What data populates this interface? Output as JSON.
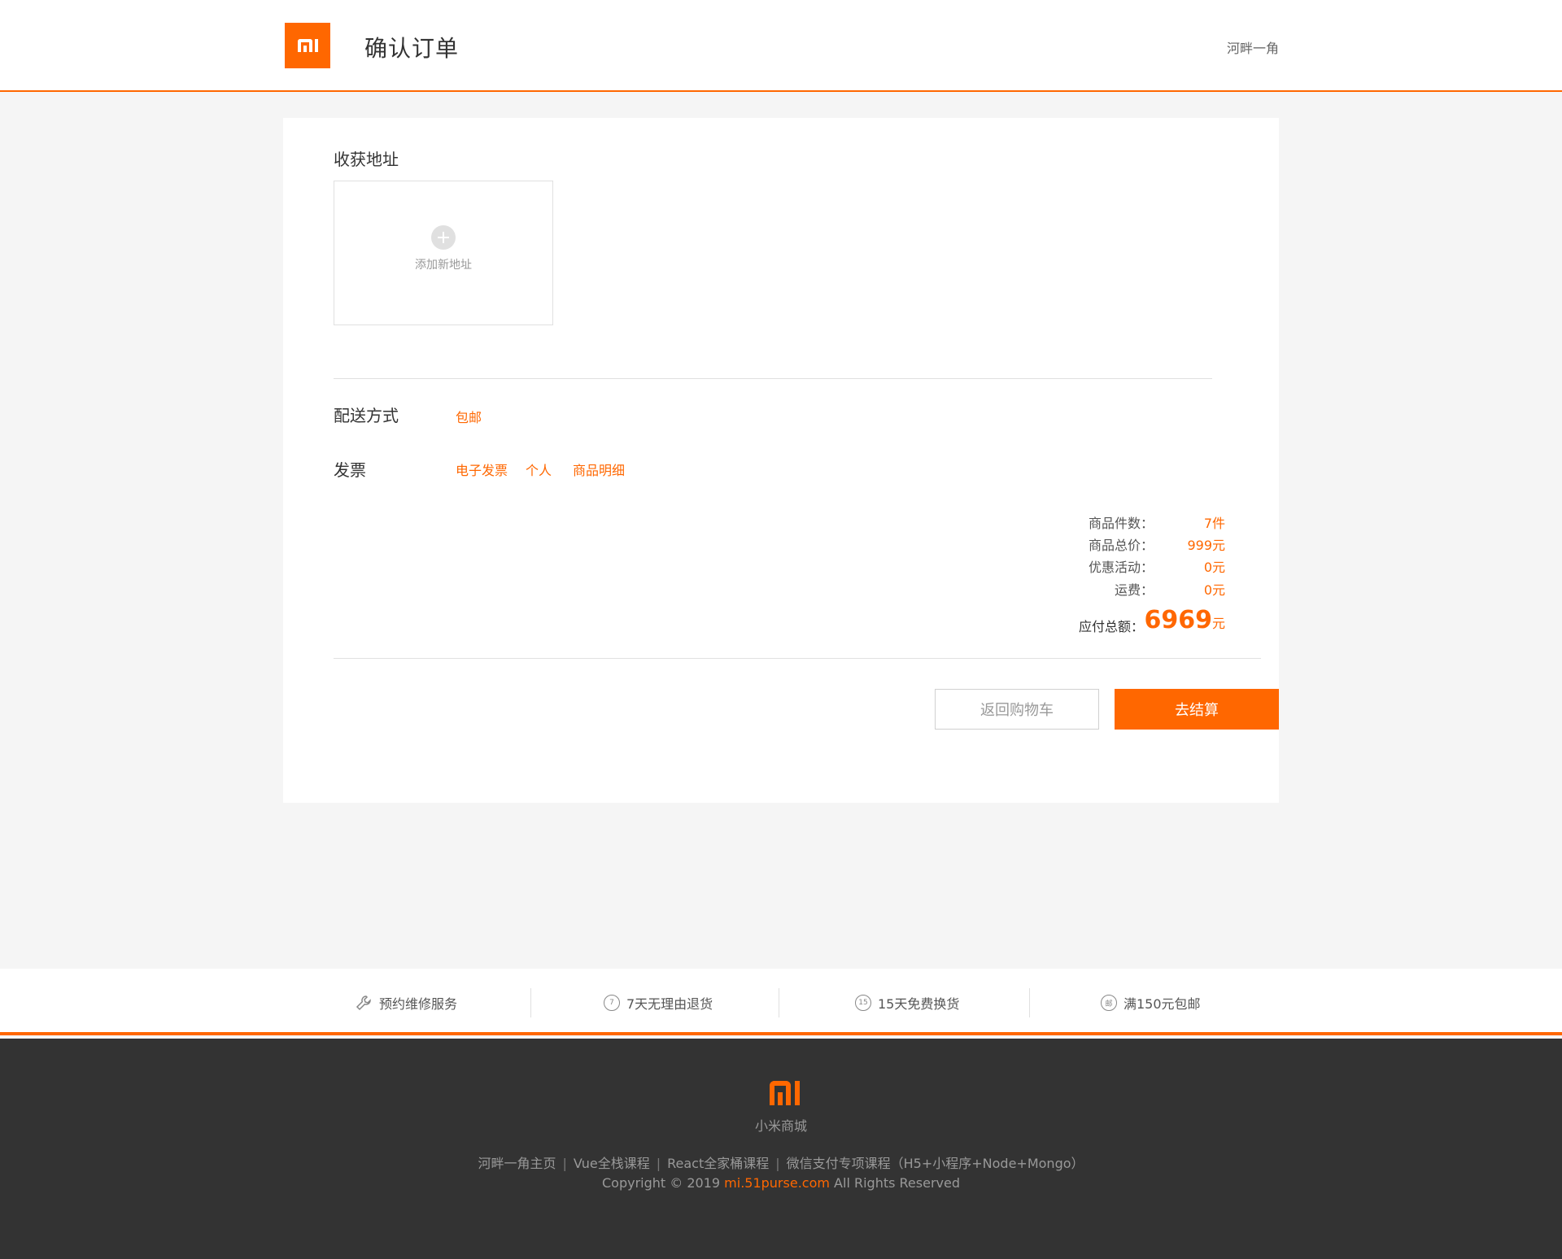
{
  "header": {
    "title": "确认订单",
    "username": "河畔一角"
  },
  "address": {
    "section_title": "收获地址",
    "add_label": "添加新地址"
  },
  "delivery": {
    "label": "配送方式",
    "value": "包邮"
  },
  "invoice": {
    "label": "发票",
    "options": [
      "电子发票",
      "个人",
      "商品明细"
    ]
  },
  "summary": {
    "item_count_label": "商品件数：",
    "item_count_value": "7件",
    "total_price_label": "商品总价：",
    "total_price_value": "999元",
    "discount_label": "优惠活动：",
    "discount_value": "0元",
    "shipping_label": "运费：",
    "shipping_value": "0元",
    "payable_label": "应付总额：",
    "payable_amount": "6969",
    "payable_unit": "元"
  },
  "buttons": {
    "back_label": "返回购物车",
    "pay_label": "去结算"
  },
  "services": [
    {
      "label": "预约维修服务",
      "icon": "wrench-icon"
    },
    {
      "label": "7天无理由退货",
      "icon": "seven-day-return-icon",
      "badge": "7"
    },
    {
      "label": "15天免费换货",
      "icon": "fifteen-day-exchange-icon",
      "badge": "15"
    },
    {
      "label": "满150元包邮",
      "icon": "free-shipping-icon",
      "badge": "邮"
    }
  ],
  "footer": {
    "brand": "小米商城",
    "links": [
      "河畔一角主页",
      "Vue全栈课程",
      "React全家桶课程",
      "微信支付专项课程（H5+小程序+Node+Mongo）"
    ],
    "copyright_prefix": "Copyright © 2019",
    "copyright_site": "mi.51purse.com",
    "copyright_suffix": "All Rights Reserved"
  },
  "colors": {
    "accent": "#ff6700",
    "footer_bg": "#333333",
    "page_bg": "#f5f5f5"
  }
}
